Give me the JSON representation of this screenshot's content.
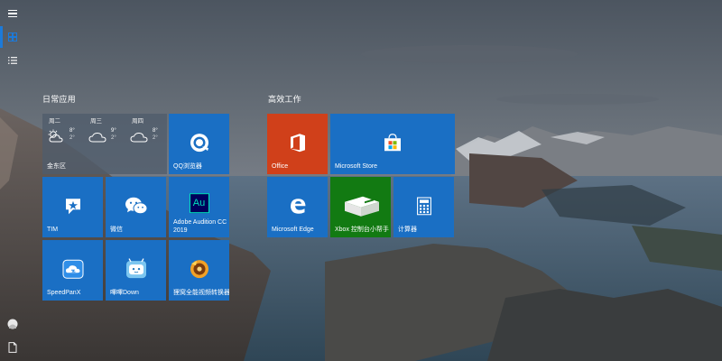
{
  "groups": {
    "daily": {
      "title": "日常应用"
    },
    "work": {
      "title": "高效工作"
    }
  },
  "weather": {
    "location": "金东区",
    "days": [
      {
        "day": "周二",
        "high": "8°",
        "low": "2°",
        "icon": "partly-sunny-icon"
      },
      {
        "day": "周三",
        "high": "9°",
        "low": "2°",
        "icon": "cloudy-icon"
      },
      {
        "day": "周四",
        "high": "8°",
        "low": "2°",
        "icon": "cloudy-icon"
      }
    ]
  },
  "tiles": {
    "qq_browser": "QQ浏览器",
    "tim": "TIM",
    "wechat": "微信",
    "audition": "Adobe Audition CC 2019",
    "audition_line1": "Adobe Audition CC",
    "audition_line2": "2019",
    "audition_icon_text": "Au",
    "speedpan": "SpeedPanX",
    "bilibili": "嗶嗶Down",
    "converter": "狸窝全能视频转换器",
    "office": "Office",
    "store": "Microsoft Store",
    "edge": "Microsoft Edge",
    "xbox": "Xbox 控制台小帮手",
    "calculator": "计算器"
  },
  "colors": {
    "tile_blue": "#1a6fc4",
    "office_orange": "#d0401a",
    "xbox_green": "#127a12",
    "accent": "#1c7ad9"
  }
}
